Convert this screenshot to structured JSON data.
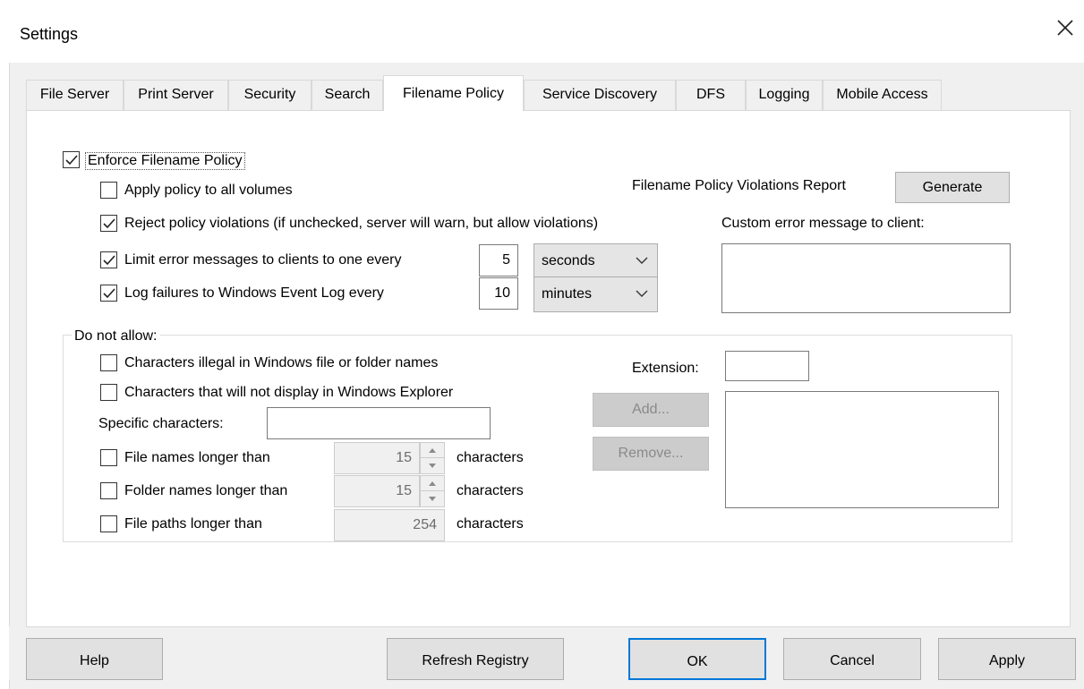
{
  "window": {
    "title": "Settings",
    "close_symbol": "✕"
  },
  "tabs": [
    {
      "label": "File Server"
    },
    {
      "label": "Print Server"
    },
    {
      "label": "Security"
    },
    {
      "label": "Search"
    },
    {
      "label": "Filename Policy",
      "active": true
    },
    {
      "label": "Service Discovery"
    },
    {
      "label": "DFS"
    },
    {
      "label": "Logging"
    },
    {
      "label": "Mobile Access"
    }
  ],
  "policy": {
    "enforce_label": "Enforce Filename Policy",
    "enforce_checked": true,
    "apply_all_label": "Apply policy to all volumes",
    "apply_all_checked": false,
    "reject_label": "Reject policy violations (if unchecked, server will warn, but allow violations)",
    "reject_checked": true,
    "limit_label": "Limit error messages to clients to one every",
    "limit_checked": true,
    "limit_value": "5",
    "limit_unit": "seconds",
    "log_label": "Log failures to Windows Event Log every",
    "log_checked": true,
    "log_value": "10",
    "log_unit": "minutes",
    "report_label": "Filename Policy Violations Report",
    "generate_label": "Generate",
    "custom_msg_label": "Custom error message to client:",
    "custom_msg_value": ""
  },
  "disallow": {
    "group_label": "Do not allow:",
    "illegal_label": "Characters illegal in Windows file or folder names",
    "illegal_checked": false,
    "nodisplay_label": "Characters that will not display in Windows Explorer",
    "nodisplay_checked": false,
    "specific_label": "Specific characters:",
    "specific_value": "",
    "filenames_label": "File names longer than",
    "filenames_checked": false,
    "filenames_value": "15",
    "foldernames_label": "Folder names longer than",
    "foldernames_checked": false,
    "foldernames_value": "15",
    "filepaths_label": "File paths longer than",
    "filepaths_checked": false,
    "filepaths_value": "254",
    "characters_unit": "characters",
    "extension_label": "Extension:",
    "extension_value": "",
    "add_label": "Add...",
    "remove_label": "Remove..."
  },
  "footer": {
    "help": "Help",
    "refresh": "Refresh Registry",
    "ok": "OK",
    "cancel": "Cancel",
    "apply": "Apply"
  }
}
